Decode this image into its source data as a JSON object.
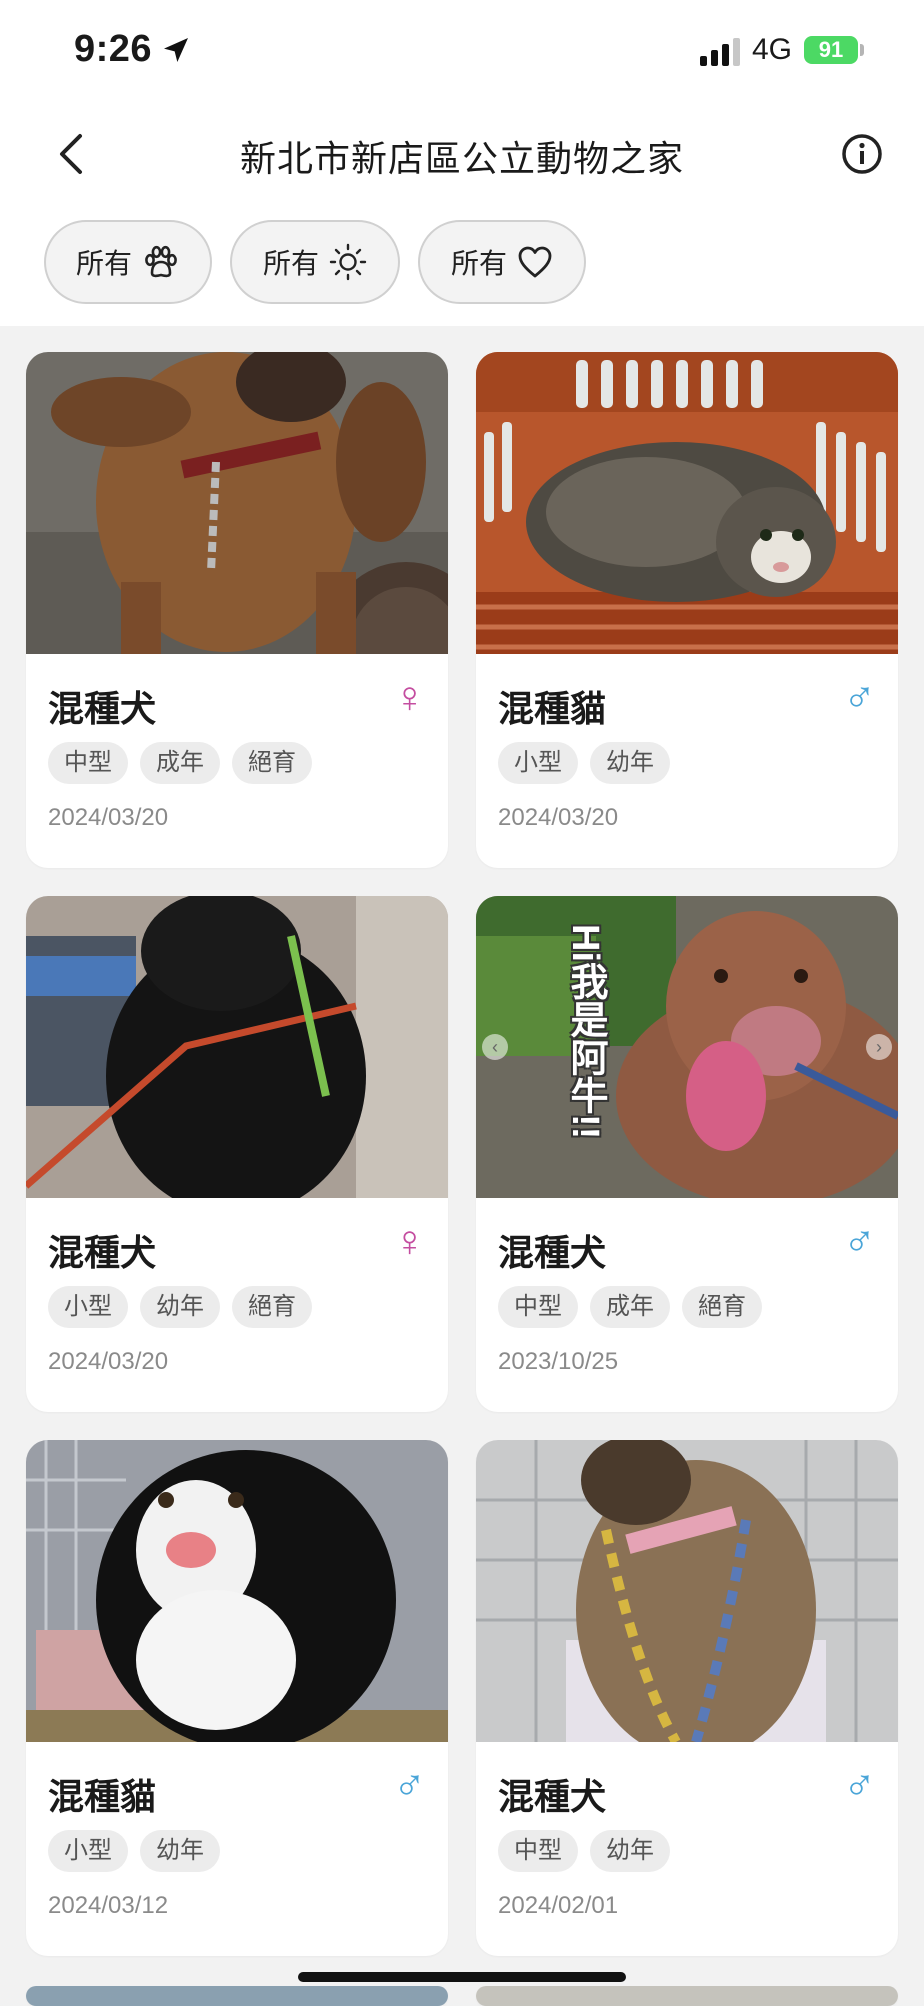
{
  "status_bar": {
    "time": "9:26",
    "network": "4G",
    "battery": "91"
  },
  "header": {
    "title": "新北市新店區公立動物之家"
  },
  "filters": [
    {
      "label": "所有",
      "icon": "paw-icon"
    },
    {
      "label": "所有",
      "icon": "sun-icon"
    },
    {
      "label": "所有",
      "icon": "heart-icon"
    }
  ],
  "pets": [
    {
      "name": "混種犬",
      "sex": "♀",
      "sex_type": "female",
      "tags": [
        "中型",
        "成年",
        "絕育"
      ],
      "date": "2024/03/20"
    },
    {
      "name": "混種貓",
      "sex": "♂",
      "sex_type": "male",
      "tags": [
        "小型",
        "幼年"
      ],
      "date": "2024/03/20"
    },
    {
      "name": "混種犬",
      "sex": "♀",
      "sex_type": "female",
      "tags": [
        "小型",
        "幼年",
        "絕育"
      ],
      "date": "2024/03/20"
    },
    {
      "name": "混種犬",
      "sex": "♂",
      "sex_type": "male",
      "tags": [
        "中型",
        "成年",
        "絕育"
      ],
      "date": "2023/10/25",
      "photo_overlay": "Hi我是阿牛!!"
    },
    {
      "name": "混種貓",
      "sex": "♂",
      "sex_type": "male",
      "tags": [
        "小型",
        "幼年"
      ],
      "date": "2024/03/12"
    },
    {
      "name": "混種犬",
      "sex": "♂",
      "sex_type": "male",
      "tags": [
        "中型",
        "幼年"
      ],
      "date": "2024/02/01"
    }
  ],
  "colors": {
    "female": "#c44da0",
    "male": "#4aa5d8",
    "battery": "#4cd964"
  }
}
